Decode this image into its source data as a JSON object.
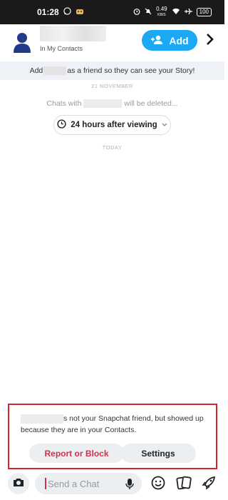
{
  "status_bar": {
    "time": "01:28",
    "speed_value": "0.49",
    "speed_unit": "KB/S",
    "battery": "100"
  },
  "header": {
    "subtitle": "In My Contacts",
    "add_label": "Add"
  },
  "banner": {
    "prefix": "Add",
    "suffix": "as a friend so they can see your Story!"
  },
  "chat": {
    "date_label": "21 NOVEMBER",
    "delete_prefix": "Chats with",
    "delete_suffix": "will be deleted...",
    "timer_label": "24 hours after viewing",
    "today_label": "TODAY"
  },
  "notice": {
    "text_suffix": "s not your Snapchat friend, but showed up because they are in your Contacts.",
    "report_label": "Report or Block",
    "settings_label": "Settings"
  },
  "input": {
    "placeholder": "Send a Chat"
  },
  "colors": {
    "accent": "#1ba8f5",
    "danger": "#d1314e",
    "highlight_border": "#d6242a"
  }
}
